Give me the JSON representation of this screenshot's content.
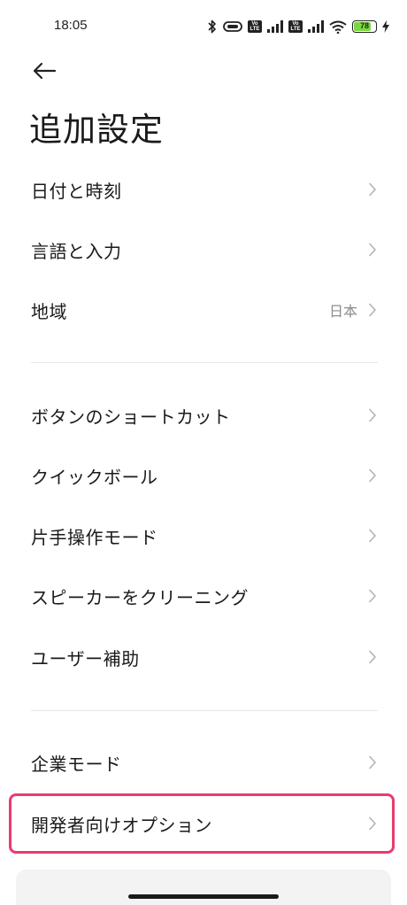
{
  "status_bar": {
    "time": "18:05",
    "volte1": "Vo LTE",
    "volte2": "Vo LTE",
    "battery_level": "78"
  },
  "header": {
    "title": "追加設定"
  },
  "items": [
    {
      "label": "日付と時刻",
      "value": ""
    },
    {
      "label": "言語と入力",
      "value": ""
    },
    {
      "label": "地域",
      "value": "日本"
    },
    {
      "label": "ボタンのショートカット",
      "value": ""
    },
    {
      "label": "クイックボール",
      "value": ""
    },
    {
      "label": "片手操作モード",
      "value": ""
    },
    {
      "label": "スピーカーをクリーニング",
      "value": ""
    },
    {
      "label": "ユーザー補助",
      "value": ""
    },
    {
      "label": "企業モード",
      "value": ""
    },
    {
      "label": "開発者向けオプション",
      "value": ""
    }
  ],
  "colors": {
    "highlight": "#e93c6f",
    "battery": "#7ad83e"
  }
}
